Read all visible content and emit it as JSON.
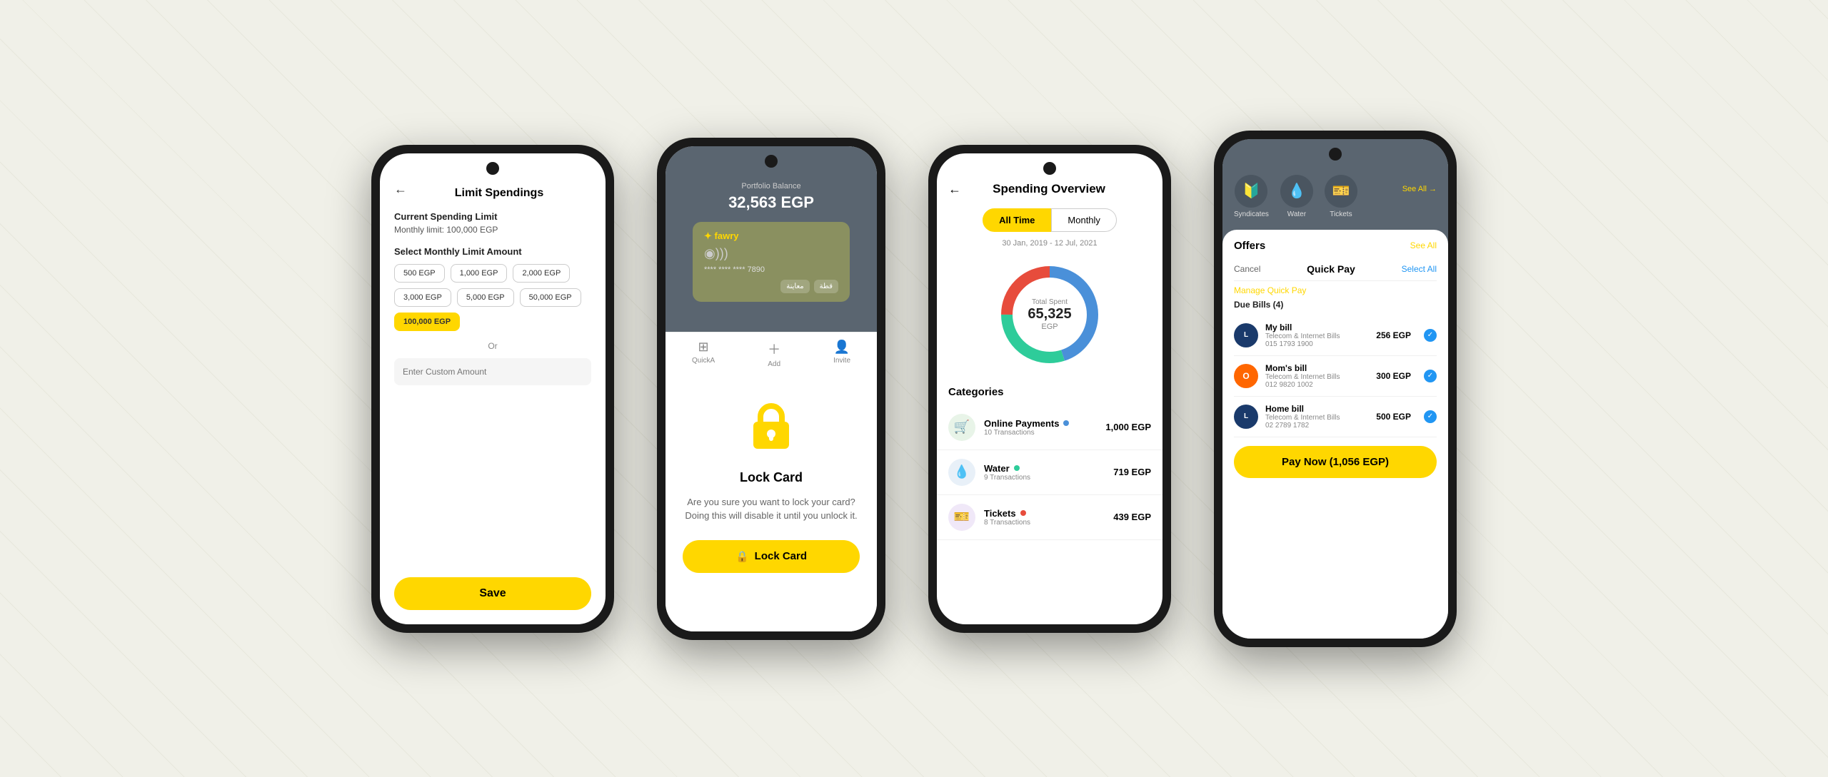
{
  "screen1": {
    "back_icon": "←",
    "title": "Limit Spendings",
    "current_limit_label": "Current Spending Limit",
    "monthly_limit_text": "Monthly limit: 100,000 EGP",
    "select_label": "Select Monthly Limit Amount",
    "chips": [
      {
        "label": "500 EGP",
        "active": false
      },
      {
        "label": "1,000 EGP",
        "active": false
      },
      {
        "label": "2,000 EGP",
        "active": false
      },
      {
        "label": "3,000 EGP",
        "active": false
      },
      {
        "label": "5,000 EGP",
        "active": false
      },
      {
        "label": "50,000 EGP",
        "active": false
      },
      {
        "label": "100,000 EGP",
        "active": true
      }
    ],
    "or_text": "Or",
    "custom_placeholder": "Enter Custom Amount",
    "save_button": "Save"
  },
  "screen2": {
    "balance_label": "Portfolio Balance",
    "balance_amount": "32,563 EGP",
    "card_name": "fawry",
    "card_chip_icon": "◉)))",
    "card_number": "**** **** **** 7890",
    "card_edit_icon": "✎",
    "card_actions": [
      "معاينة",
      "قطة"
    ],
    "nav_items": [
      {
        "icon": "⊞",
        "label": "QuickA"
      },
      {
        "icon": "+",
        "label": "Add"
      },
      {
        "icon": "👤",
        "label": "Invite"
      }
    ],
    "modal_title": "Lock Card",
    "modal_description": "Are you sure you want to lock your card? Doing this will disable it until you unlock it.",
    "lock_button": "Lock Card",
    "lock_icon": "🔒"
  },
  "screen3": {
    "back_icon": "←",
    "title": "Spending Overview",
    "tabs": [
      {
        "label": "All Time",
        "active": true
      },
      {
        "label": "Monthly",
        "active": false
      }
    ],
    "date_range": "30 Jan, 2019 - 12 Jul, 2021",
    "chart": {
      "total_label": "Total Spent",
      "total_amount": "65,325",
      "currency": "EGP",
      "segments": [
        {
          "color": "#4a90d9",
          "pct": 45
        },
        {
          "color": "#2ecc9a",
          "pct": 30
        },
        {
          "color": "#e74c3c",
          "pct": 25
        }
      ]
    },
    "categories_title": "Categories",
    "categories": [
      {
        "icon": "🛒",
        "icon_class": "online",
        "name": "Online Payments",
        "dot_class": "dot-blue",
        "transactions": "10 Transactions",
        "amount": "1,000 EGP"
      },
      {
        "icon": "💧",
        "icon_class": "water",
        "name": "Water",
        "dot_class": "dot-teal",
        "transactions": "9 Transactions",
        "amount": "719 EGP"
      },
      {
        "icon": "🎫",
        "icon_class": "tickets",
        "name": "Tickets",
        "dot_class": "dot-red",
        "transactions": "8 Transactions",
        "amount": "439 EGP"
      }
    ]
  },
  "screen4": {
    "services": [
      {
        "icon": "🔰",
        "label": "Syndicates"
      },
      {
        "icon": "💧",
        "label": "Water"
      },
      {
        "icon": "🎫",
        "label": "Tickets"
      }
    ],
    "see_all_label": "See All →",
    "offers_title": "Offers",
    "see_all_offers": "See All",
    "quick_pay_cancel": "Cancel",
    "quick_pay_title": "Quick Pay",
    "quick_pay_select_all": "Select All",
    "manage_link": "Manage Quick Pay",
    "due_bills_label": "Due Bills (4)",
    "bills": [
      {
        "logo_class": "lari",
        "logo_text": "L",
        "name": "My bill",
        "description": "Telecom & Internet Bills",
        "phone": "015 1793 1900",
        "amount": "256 EGP"
      },
      {
        "logo_class": "orange",
        "logo_text": "O",
        "name": "Mom's bill",
        "description": "Telecom & Internet Bills",
        "phone": "012 9820 1002",
        "amount": "300 EGP"
      },
      {
        "logo_class": "lari2",
        "logo_text": "L",
        "name": "Home bill",
        "description": "Telecom & Internet Bills",
        "phone": "02 2789 1782",
        "amount": "500 EGP"
      }
    ],
    "pay_now_label": "Pay Now (1,056 EGP)"
  }
}
